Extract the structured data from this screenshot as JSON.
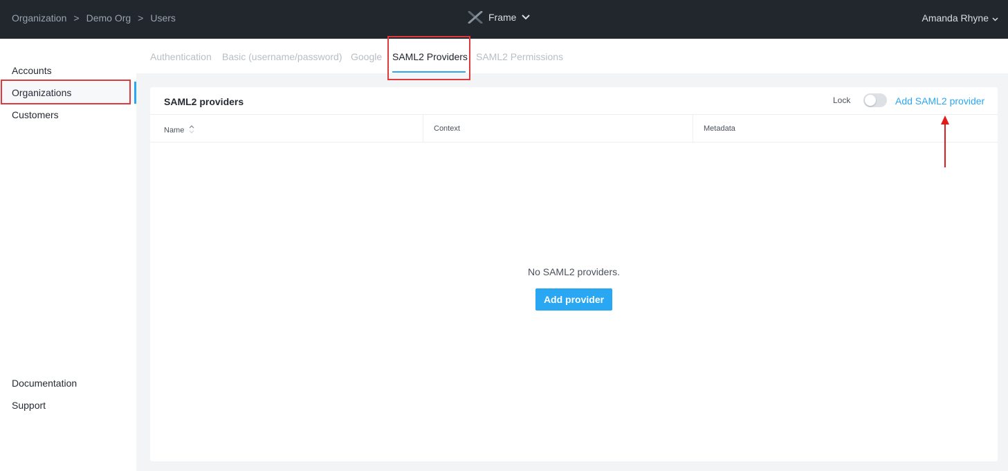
{
  "breadcrumb": {
    "items": [
      "Organization",
      "Demo Org",
      "Users"
    ],
    "separator": ">"
  },
  "brand": {
    "label": "Frame"
  },
  "user": {
    "name": "Amanda Rhyne"
  },
  "sidebar": {
    "items": [
      {
        "label": "Accounts"
      },
      {
        "label": "Organizations",
        "active": true
      },
      {
        "label": "Customers"
      }
    ],
    "bottom_items": [
      {
        "label": "Documentation"
      },
      {
        "label": "Support"
      }
    ]
  },
  "tabs": [
    {
      "label": "Authentication"
    },
    {
      "label": "Basic (username/password)"
    },
    {
      "label": "Google"
    },
    {
      "label": "SAML2 Providers",
      "active": true
    },
    {
      "label": "SAML2 Permissions"
    }
  ],
  "panel": {
    "title": "SAML2 providers",
    "lock_label": "Lock",
    "lock_enabled": false,
    "add_link": "Add SAML2 provider",
    "columns": [
      "Name",
      "Context",
      "Metadata"
    ],
    "empty_message": "No SAML2 providers.",
    "add_button": "Add provider"
  },
  "colors": {
    "accent": "#2aa7f2",
    "highlight": "#e0393c",
    "topbar": "#22272e"
  }
}
